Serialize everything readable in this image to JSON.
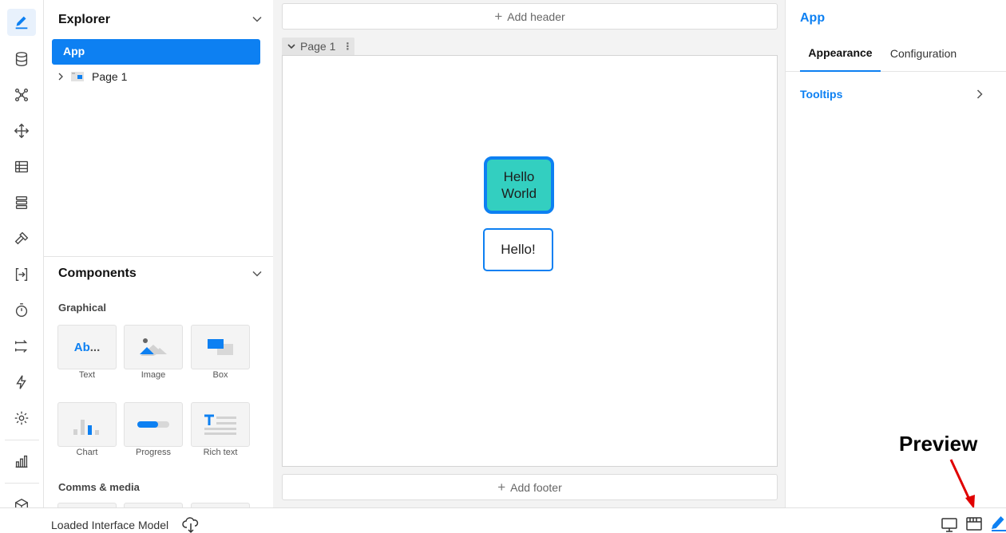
{
  "rail": {
    "icons": [
      "edit-icon",
      "database-icon",
      "network-icon",
      "move-icon",
      "table-icon",
      "list-icon",
      "hammer-icon",
      "import-icon",
      "timer-icon",
      "routing-icon",
      "lightning-icon",
      "gear-icon",
      "chart-icon",
      "cube-icon"
    ],
    "active_index": 0
  },
  "explorer": {
    "title": "Explorer",
    "root_item": "App",
    "page_item": "Page 1"
  },
  "components": {
    "title": "Components",
    "graphical_label": "Graphical",
    "items": [
      {
        "label": "Text",
        "icon_text_main": "Ab",
        "icon_text_tail": "..."
      },
      {
        "label": "Image"
      },
      {
        "label": "Box"
      },
      {
        "label": "Chart"
      },
      {
        "label": "Progress"
      },
      {
        "label": "Rich text"
      }
    ],
    "comms_label": "Comms & media"
  },
  "canvas": {
    "add_header": "Add header",
    "page_tab": "Page 1",
    "hello_world": "Hello World",
    "hello_button": "Hello!",
    "add_footer": "Add footer"
  },
  "right_panel": {
    "title": "App",
    "tabs": [
      "Appearance",
      "Configuration"
    ],
    "active_tab": "Appearance",
    "section": "Tooltips"
  },
  "annotation": {
    "label": "Preview"
  },
  "status": {
    "text": "Loaded Interface Model"
  },
  "colors": {
    "accent": "#0d80f2",
    "teal": "#33cfc0",
    "arrow": "#e00000"
  }
}
